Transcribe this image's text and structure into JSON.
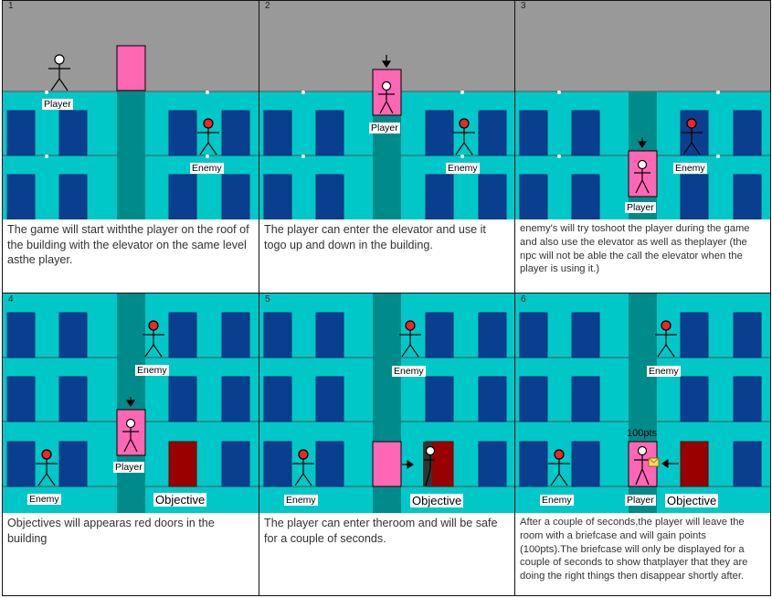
{
  "panels": [
    {
      "number": "1",
      "caption": "The game will start withthe player on the roof of the building with the elevator on the same level asthe player."
    },
    {
      "number": "2",
      "caption": "The player can enter the elevator and use it togo up and down in the building."
    },
    {
      "number": "3",
      "caption": "enemy's will try toshoot the player during the game and also use the elevator as well as theplayer (the npc will not be able the call the elevator when the player is using it.)"
    },
    {
      "number": "4",
      "caption": "Objectives will appearas red doors in the building"
    },
    {
      "number": "5",
      "caption": "The player can enter theroom and will be safe for a couple of seconds."
    },
    {
      "number": "6",
      "caption": "After a couple of seconds,the player will leave the room with a briefcase and will gain points (100pts).The briefcase will only be displayed for a couple of seconds to show thatplayer that they are doing the right things then disappear shortly after."
    }
  ],
  "labels": {
    "player": "Player",
    "enemy": "Enemy",
    "objective": "Objective",
    "points": "100pts"
  },
  "colors": {
    "roof": "#999999",
    "wall": "#00c8c8",
    "shaft": "#008b8b",
    "elevator": "#ff66b3",
    "door": "#0a3f8f",
    "objective_door": "#990000",
    "enemy_head": "#ff2020"
  }
}
